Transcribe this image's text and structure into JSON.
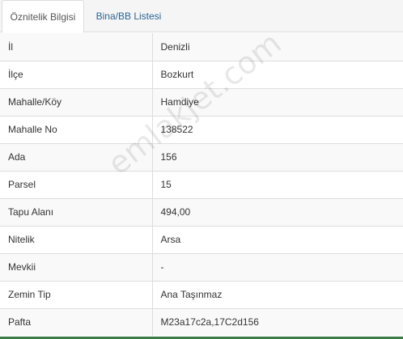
{
  "tabs": [
    {
      "label": "Öznitelik Bilgisi",
      "active": true
    },
    {
      "label": "Bina/BB Listesi",
      "active": false
    }
  ],
  "attributes": [
    {
      "key": "İl",
      "value": "Denizli"
    },
    {
      "key": "İlçe",
      "value": "Bozkurt"
    },
    {
      "key": "Mahalle/Köy",
      "value": "Hamdiye"
    },
    {
      "key": "Mahalle No",
      "value": "138522"
    },
    {
      "key": "Ada",
      "value": "156"
    },
    {
      "key": "Parsel",
      "value": "15"
    },
    {
      "key": "Tapu Alanı",
      "value": "494,00"
    },
    {
      "key": "Nitelik",
      "value": "Arsa"
    },
    {
      "key": "Mevkii",
      "value": "-"
    },
    {
      "key": "Zemin Tip",
      "value": "Ana Taşınmaz"
    },
    {
      "key": "Pafta",
      "value": "M23a17c2a,17C2d156"
    }
  ],
  "watermark": "emlakjet.com",
  "colors": {
    "tab_link": "#2a6496",
    "border": "#dddddd",
    "stripe": "#f9f9f9",
    "footer_accent": "#3a7d44"
  }
}
